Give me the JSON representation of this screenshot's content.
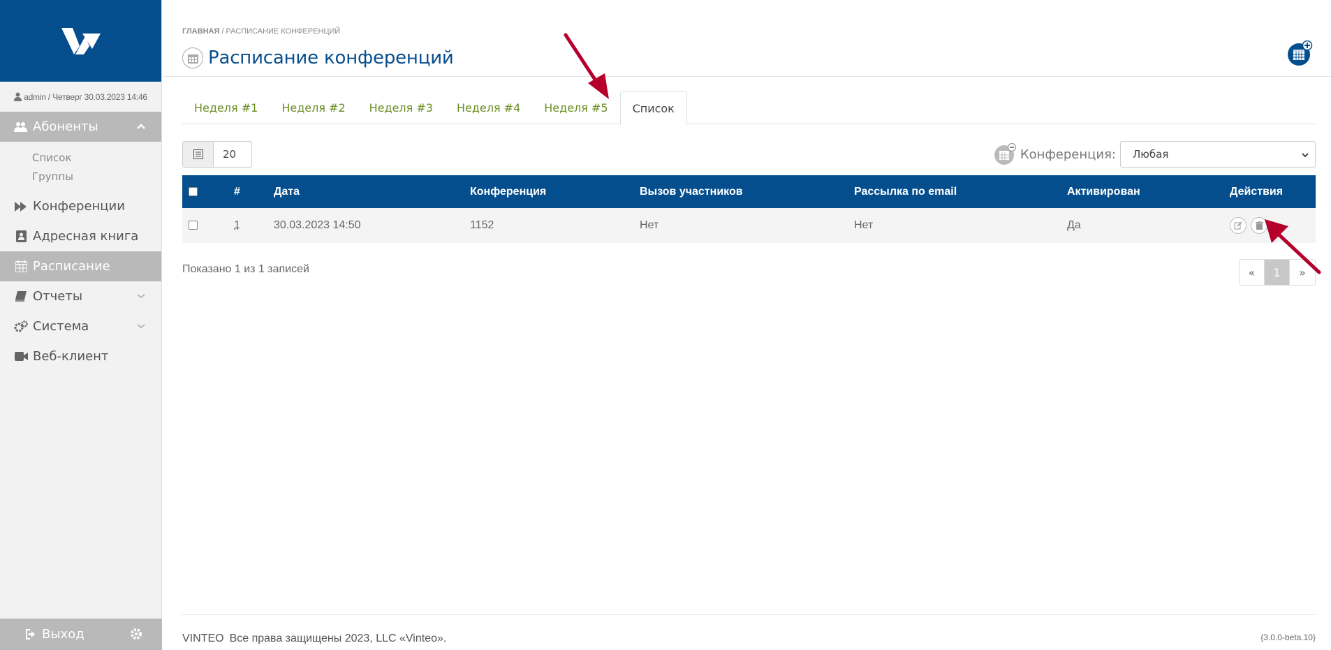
{
  "sidebar": {
    "user_line": "admin / Четверг 30.03.2023 14:46",
    "nav": {
      "subscribers": "Абоненты",
      "subscribers_sub": [
        "Список",
        "Группы"
      ],
      "conferences": "Конференции",
      "address_book": "Адресная книга",
      "schedule": "Расписание",
      "reports": "Отчеты",
      "system": "Система",
      "web_client": "Веб-клиент"
    },
    "logout": "Выход"
  },
  "header": {
    "breadcrumb_home": "ГЛАВНАЯ",
    "breadcrumb_current": "/  РАСПИСАНИЕ КОНФЕРЕНЦИЙ",
    "title": "Расписание конференций"
  },
  "tabs": [
    "Неделя #1",
    "Неделя #2",
    "Неделя #3",
    "Неделя #4",
    "Неделя #5",
    "Список"
  ],
  "active_tab": "Список",
  "toolbar": {
    "page_size": "20",
    "conference_label": "Конференция:",
    "conference_value": "Любая"
  },
  "table": {
    "headers": [
      "#",
      "Дата",
      "Конференция",
      "Вызов участников",
      "Рассылка по email",
      "Активирован",
      "Действия"
    ],
    "rows": [
      [
        "1",
        "30.03.2023 14:50",
        "1152",
        "Нет",
        "Нет",
        "Да"
      ]
    ]
  },
  "pagination": {
    "info": "Показано 1 из 1 записей",
    "prev": "«",
    "current": "1",
    "next": "»"
  },
  "footer": {
    "brand": "VINTEO",
    "copyright": "Все права защищены 2023, LLC «Vinteo».",
    "version": "{3.0.0-beta.10}"
  },
  "colors": {
    "primary": "#044e8e",
    "tab_link": "#6b8e23",
    "annotation_arrow": "#b5002b"
  }
}
